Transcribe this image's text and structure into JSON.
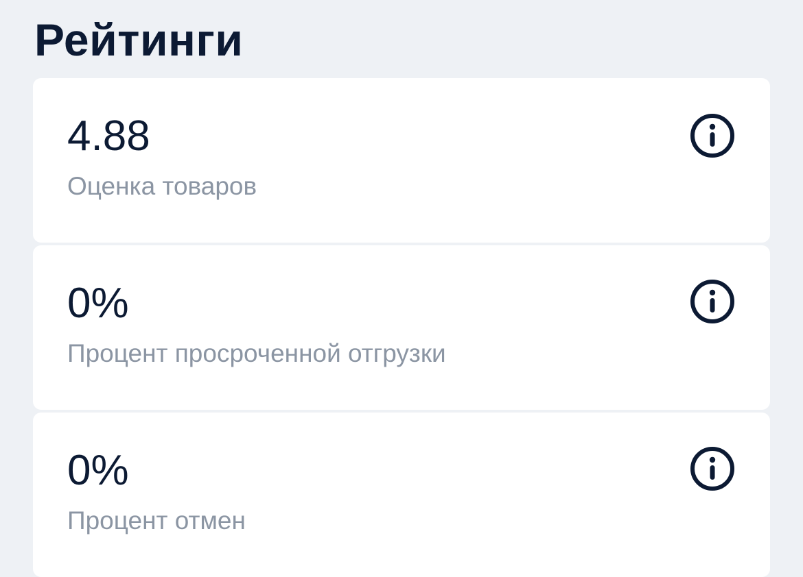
{
  "header": {
    "title": "Рейтинги"
  },
  "metrics": [
    {
      "value": "4.88",
      "label": "Оценка товаров",
      "icon": "info-icon"
    },
    {
      "value": "0%",
      "label": "Процент просроченной отгрузки",
      "icon": "info-icon"
    },
    {
      "value": "0%",
      "label": "Процент отмен",
      "icon": "info-icon"
    }
  ],
  "colors": {
    "background": "#eef1f5",
    "card": "#ffffff",
    "primary_text": "#0c1a33",
    "secondary_text": "#8b95a3"
  }
}
